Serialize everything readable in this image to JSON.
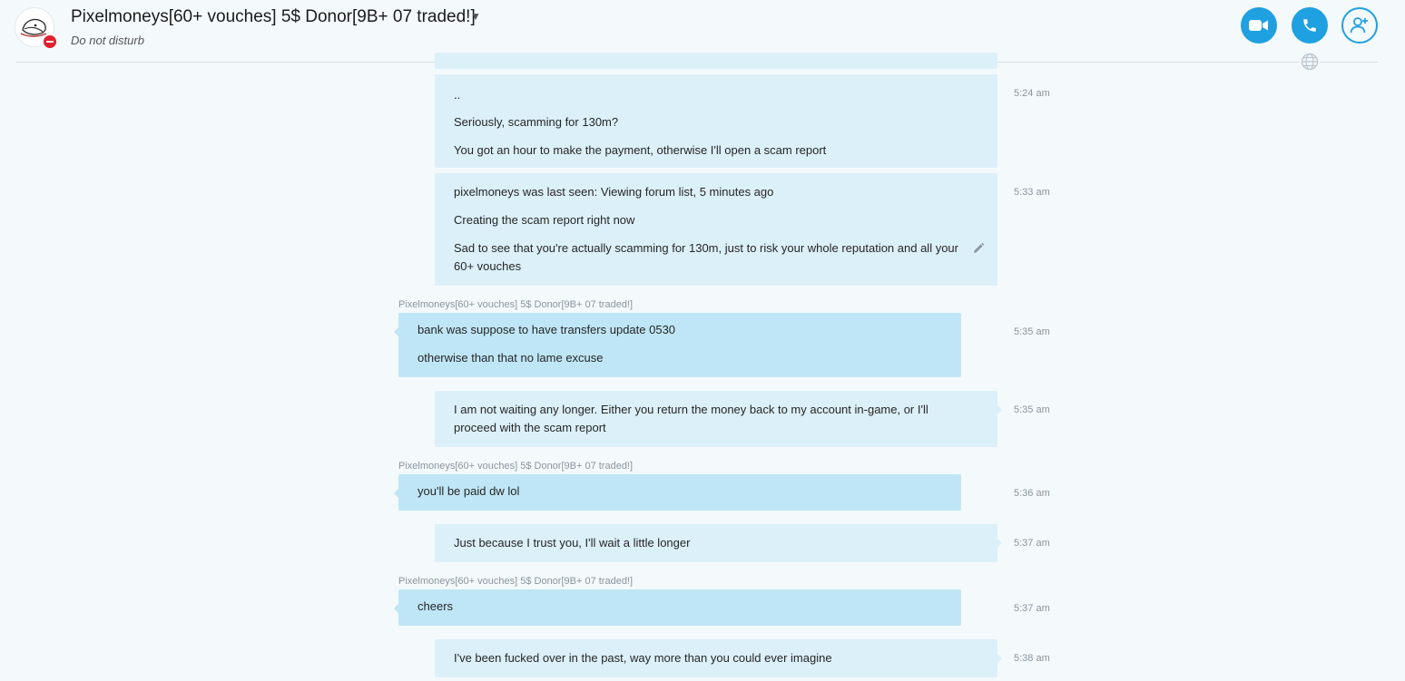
{
  "header": {
    "title": "Pixelmoneys[60+ vouches] 5$ Donor[9B+ 07 traded!]",
    "status": "Do not disturb"
  },
  "colors": {
    "accent": "#1fa0e0",
    "dnd": "#e0202c",
    "my_bubble": "#dcf0f9",
    "their_bubble": "#bfe6f6"
  },
  "icons": {
    "video": "video-call-icon",
    "call": "phone-icon",
    "add": "add-person-icon",
    "globe": "globe-icon",
    "edit": "pencil-icon"
  },
  "messages": [
    {
      "from": "me",
      "time": "5:24 am",
      "lines": [
        "..",
        "Seriously, scamming for 130m?",
        "You got an hour to make the payment, otherwise I'll open a scam report"
      ]
    },
    {
      "from": "me",
      "time": "5:33 am",
      "lines": [
        "pixelmoneys was last seen: Viewing forum list, 5 minutes ago",
        "Creating the scam report right now",
        "Sad to see that you're actually scamming for 130m, just to risk your whole reputation and all your 60+ vouches"
      ]
    },
    {
      "from": "them",
      "sender": "Pixelmoneys[60+ vouches] 5$ Donor[9B+ 07 traded!]",
      "time": "5:35 am",
      "lines": [
        "bank was suppose to have transfers update 0530",
        "otherwise  than that no lame excuse"
      ]
    },
    {
      "from": "me",
      "time": "5:35 am",
      "lines": [
        "I am not waiting any longer. Either you return the money back to my account in-game, or I'll proceed with the scam report"
      ]
    },
    {
      "from": "them",
      "sender": "Pixelmoneys[60+ vouches] 5$ Donor[9B+ 07 traded!]",
      "time": "5:36 am",
      "lines": [
        "you'll be paid dw lol"
      ]
    },
    {
      "from": "me",
      "time": "5:37 am",
      "lines": [
        "Just because I trust you, I'll wait a little longer"
      ]
    },
    {
      "from": "them",
      "sender": "Pixelmoneys[60+ vouches] 5$ Donor[9B+ 07 traded!]",
      "time": "5:37 am",
      "lines": [
        "cheers"
      ]
    },
    {
      "from": "me",
      "time": "5:38 am",
      "lines": [
        "I've been fucked over in the past, way more than you could ever imagine"
      ]
    }
  ]
}
